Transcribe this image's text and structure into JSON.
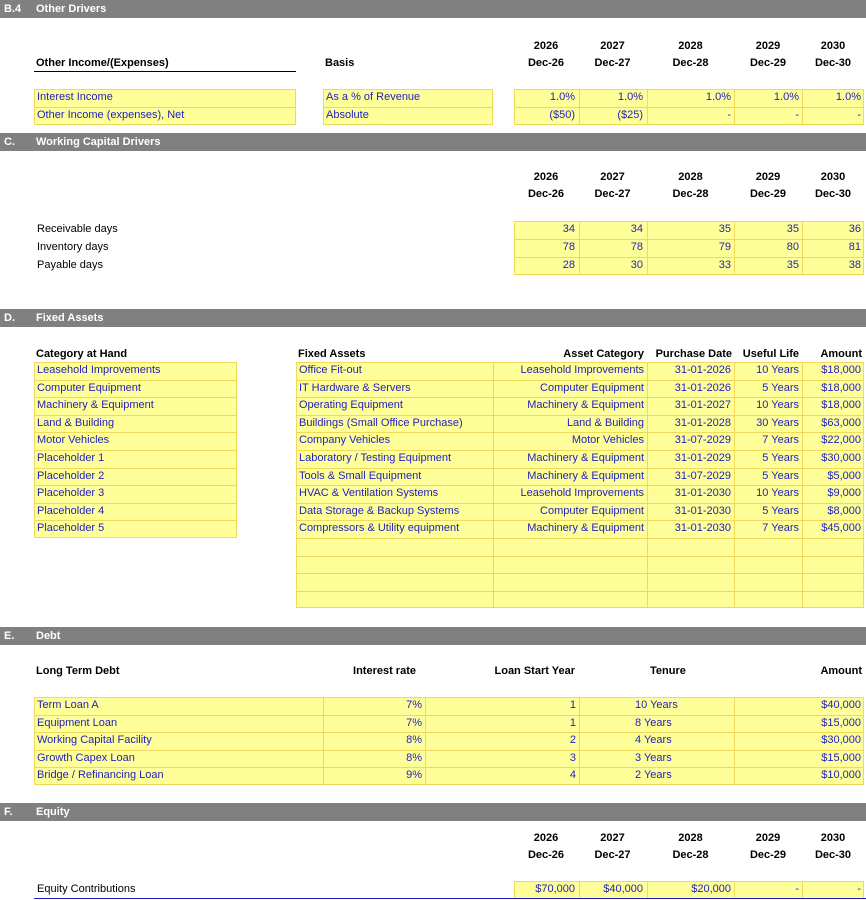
{
  "other_drivers": {
    "code": "B.4",
    "title": "Other Drivers",
    "col_header": "Other Income/(Expenses)",
    "basis_header": "Basis",
    "years": [
      "2026",
      "2027",
      "2028",
      "2029",
      "2030"
    ],
    "dates": [
      "Dec-26",
      "Dec-27",
      "Dec-28",
      "Dec-29",
      "Dec-30"
    ],
    "rows": [
      {
        "label": "Interest Income",
        "basis": "As a % of Revenue",
        "values": [
          "1.0%",
          "1.0%",
          "1.0%",
          "1.0%",
          "1.0%"
        ]
      },
      {
        "label": "Other Income (expenses), Net",
        "basis": "Absolute",
        "values": [
          "($50)",
          "($25)",
          "-",
          "-",
          "-"
        ]
      }
    ]
  },
  "working_capital": {
    "code": "C.",
    "title": "Working Capital Drivers",
    "years": [
      "2026",
      "2027",
      "2028",
      "2029",
      "2030"
    ],
    "dates": [
      "Dec-26",
      "Dec-27",
      "Dec-28",
      "Dec-29",
      "Dec-30"
    ],
    "rows": [
      {
        "label": "Receivable days",
        "values": [
          "34",
          "34",
          "35",
          "35",
          "36"
        ]
      },
      {
        "label": "Inventory days",
        "values": [
          "78",
          "78",
          "79",
          "80",
          "81"
        ]
      },
      {
        "label": "Payable days",
        "values": [
          "28",
          "30",
          "33",
          "35",
          "38"
        ]
      }
    ]
  },
  "fixed_assets": {
    "code": "D.",
    "title": "Fixed Assets",
    "category_header": "Category at Hand",
    "categories": [
      "Leasehold Improvements",
      "Computer Equipment",
      "Machinery & Equipment",
      "Land & Building",
      "Motor Vehicles",
      "Placeholder 1",
      "Placeholder 2",
      "Placeholder 3",
      "Placeholder 4",
      "Placeholder 5"
    ],
    "headers": {
      "asset": "Fixed Assets",
      "category": "Asset Category",
      "date": "Purchase Date",
      "life": "Useful Life",
      "amount": "Amount"
    },
    "assets": [
      {
        "name": "Office Fit-out",
        "category": "Leasehold Improvements",
        "date": "31-01-2026",
        "life": "10 Years",
        "amount": "$18,000"
      },
      {
        "name": "IT Hardware & Servers",
        "category": "Computer Equipment",
        "date": "31-01-2026",
        "life": "5 Years",
        "amount": "$18,000"
      },
      {
        "name": "Operating Equipment",
        "category": "Machinery & Equipment",
        "date": "31-01-2027",
        "life": "10 Years",
        "amount": "$18,000"
      },
      {
        "name": "Buildings (Small Office Purchase)",
        "category": "Land & Building",
        "date": "31-01-2028",
        "life": "30 Years",
        "amount": "$63,000"
      },
      {
        "name": "Company Vehicles",
        "category": "Motor Vehicles",
        "date": "31-07-2029",
        "life": "7 Years",
        "amount": "$22,000"
      },
      {
        "name": "Laboratory / Testing Equipment",
        "category": "Machinery & Equipment",
        "date": "31-01-2029",
        "life": "5 Years",
        "amount": "$30,000"
      },
      {
        "name": "Tools & Small Equipment",
        "category": "Machinery & Equipment",
        "date": "31-07-2029",
        "life": "5 Years",
        "amount": "$5,000"
      },
      {
        "name": "HVAC & Ventilation Systems",
        "category": "Leasehold Improvements",
        "date": "31-01-2030",
        "life": "10 Years",
        "amount": "$9,000"
      },
      {
        "name": "Data Storage & Backup Systems",
        "category": "Computer Equipment",
        "date": "31-01-2030",
        "life": "5 Years",
        "amount": "$8,000"
      },
      {
        "name": "Compressors & Utility equipment",
        "category": "Machinery & Equipment",
        "date": "31-01-2030",
        "life": "7 Years",
        "amount": "$45,000"
      }
    ]
  },
  "debt": {
    "code": "E.",
    "title": "Debt",
    "headers": {
      "name": "Long Term Debt",
      "rate": "Interest rate",
      "start": "Loan Start Year",
      "tenure": "Tenure",
      "amount": "Amount"
    },
    "loans": [
      {
        "name": "Term Loan A",
        "rate": "7%",
        "start": "1",
        "tenure": "10 Years",
        "amount": "$40,000"
      },
      {
        "name": "Equipment Loan",
        "rate": "7%",
        "start": "1",
        "tenure": "8 Years",
        "amount": "$15,000"
      },
      {
        "name": "Working Capital Facility",
        "rate": "8%",
        "start": "2",
        "tenure": "4 Years",
        "amount": "$30,000"
      },
      {
        "name": "Growth Capex Loan",
        "rate": "8%",
        "start": "3",
        "tenure": "3 Years",
        "amount": "$15,000"
      },
      {
        "name": "Bridge / Refinancing Loan",
        "rate": "9%",
        "start": "4",
        "tenure": "2 Years",
        "amount": "$10,000"
      }
    ]
  },
  "equity": {
    "code": "F.",
    "title": "Equity",
    "years": [
      "2026",
      "2027",
      "2028",
      "2029",
      "2030"
    ],
    "dates": [
      "Dec-26",
      "Dec-27",
      "Dec-28",
      "Dec-29",
      "Dec-30"
    ],
    "rows": [
      {
        "label": "Equity Contributions",
        "values": [
          "$70,000",
          "$40,000",
          "$20,000",
          "-",
          "-"
        ]
      }
    ]
  }
}
